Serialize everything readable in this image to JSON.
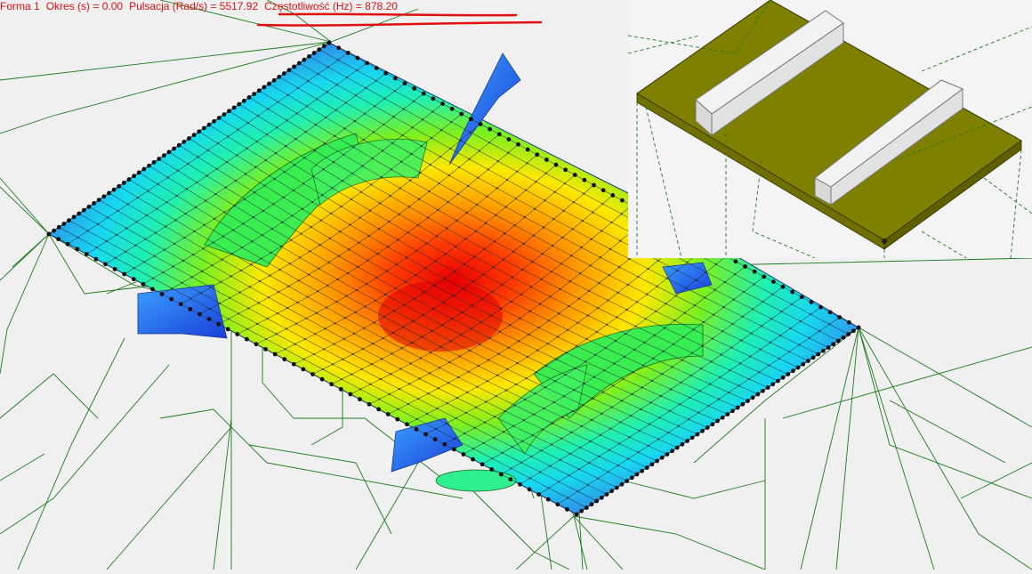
{
  "status": {
    "forma": "Forma 1",
    "okres": "Okres (s) = 0.00",
    "pulsacja": "Pulsacja (Rad/s) = 5517.92",
    "czestotliwosc": "Częstotliwość (Hz) = 878.20"
  },
  "colors": {
    "background": "#f0f0f0",
    "wireframe": "#1f7a1f",
    "status_text": "#e01010",
    "annotation_underline": "#e01010",
    "slab_olive": "#808000",
    "beam_light": "#e6e6e6",
    "mode_max": "#ff0000",
    "mode_min": "#1e50e0"
  },
  "scene": {
    "view": "3D isometric",
    "result": "modal shape",
    "mesh_divisions": 28,
    "node_marker": "black dot"
  }
}
